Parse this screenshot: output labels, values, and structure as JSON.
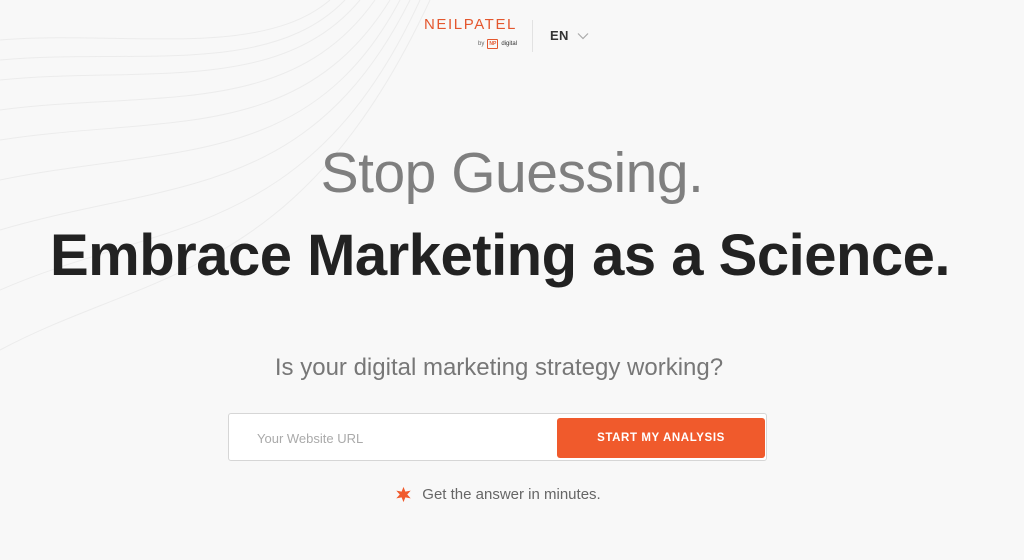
{
  "brand": {
    "wordmark": "NEILPATEL",
    "by": "by",
    "np_mark": "NP",
    "company": "digital",
    "accent_color": "#e4572e"
  },
  "language": {
    "selected": "EN",
    "icon": "chevron-down-icon"
  },
  "hero": {
    "headline_1": "Stop Guessing.",
    "headline_2": "Embrace Marketing as a Science.",
    "question": "Is your digital marketing strategy working?"
  },
  "form": {
    "url_placeholder": "Your Website URL",
    "url_value": "",
    "submit_label": "START MY ANALYSIS",
    "button_color": "#f05a2c"
  },
  "note": {
    "icon": "star-icon",
    "text": "Get the answer in minutes."
  }
}
